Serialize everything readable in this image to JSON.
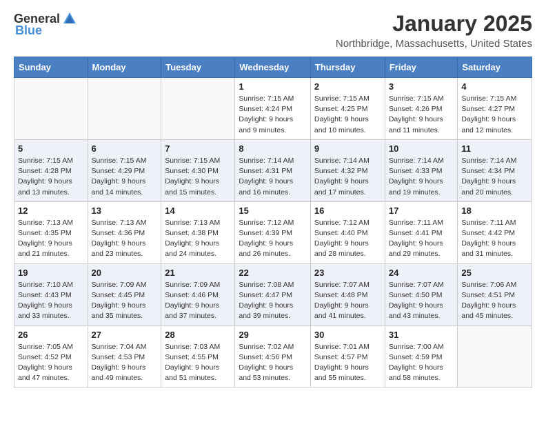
{
  "header": {
    "logo_general": "General",
    "logo_blue": "Blue",
    "month_title": "January 2025",
    "location": "Northbridge, Massachusetts, United States"
  },
  "days_of_week": [
    "Sunday",
    "Monday",
    "Tuesday",
    "Wednesday",
    "Thursday",
    "Friday",
    "Saturday"
  ],
  "weeks": [
    [
      {
        "day": "",
        "info": ""
      },
      {
        "day": "",
        "info": ""
      },
      {
        "day": "",
        "info": ""
      },
      {
        "day": "1",
        "info": "Sunrise: 7:15 AM\nSunset: 4:24 PM\nDaylight: 9 hours\nand 9 minutes."
      },
      {
        "day": "2",
        "info": "Sunrise: 7:15 AM\nSunset: 4:25 PM\nDaylight: 9 hours\nand 10 minutes."
      },
      {
        "day": "3",
        "info": "Sunrise: 7:15 AM\nSunset: 4:26 PM\nDaylight: 9 hours\nand 11 minutes."
      },
      {
        "day": "4",
        "info": "Sunrise: 7:15 AM\nSunset: 4:27 PM\nDaylight: 9 hours\nand 12 minutes."
      }
    ],
    [
      {
        "day": "5",
        "info": "Sunrise: 7:15 AM\nSunset: 4:28 PM\nDaylight: 9 hours\nand 13 minutes."
      },
      {
        "day": "6",
        "info": "Sunrise: 7:15 AM\nSunset: 4:29 PM\nDaylight: 9 hours\nand 14 minutes."
      },
      {
        "day": "7",
        "info": "Sunrise: 7:15 AM\nSunset: 4:30 PM\nDaylight: 9 hours\nand 15 minutes."
      },
      {
        "day": "8",
        "info": "Sunrise: 7:14 AM\nSunset: 4:31 PM\nDaylight: 9 hours\nand 16 minutes."
      },
      {
        "day": "9",
        "info": "Sunrise: 7:14 AM\nSunset: 4:32 PM\nDaylight: 9 hours\nand 17 minutes."
      },
      {
        "day": "10",
        "info": "Sunrise: 7:14 AM\nSunset: 4:33 PM\nDaylight: 9 hours\nand 19 minutes."
      },
      {
        "day": "11",
        "info": "Sunrise: 7:14 AM\nSunset: 4:34 PM\nDaylight: 9 hours\nand 20 minutes."
      }
    ],
    [
      {
        "day": "12",
        "info": "Sunrise: 7:13 AM\nSunset: 4:35 PM\nDaylight: 9 hours\nand 21 minutes."
      },
      {
        "day": "13",
        "info": "Sunrise: 7:13 AM\nSunset: 4:36 PM\nDaylight: 9 hours\nand 23 minutes."
      },
      {
        "day": "14",
        "info": "Sunrise: 7:13 AM\nSunset: 4:38 PM\nDaylight: 9 hours\nand 24 minutes."
      },
      {
        "day": "15",
        "info": "Sunrise: 7:12 AM\nSunset: 4:39 PM\nDaylight: 9 hours\nand 26 minutes."
      },
      {
        "day": "16",
        "info": "Sunrise: 7:12 AM\nSunset: 4:40 PM\nDaylight: 9 hours\nand 28 minutes."
      },
      {
        "day": "17",
        "info": "Sunrise: 7:11 AM\nSunset: 4:41 PM\nDaylight: 9 hours\nand 29 minutes."
      },
      {
        "day": "18",
        "info": "Sunrise: 7:11 AM\nSunset: 4:42 PM\nDaylight: 9 hours\nand 31 minutes."
      }
    ],
    [
      {
        "day": "19",
        "info": "Sunrise: 7:10 AM\nSunset: 4:43 PM\nDaylight: 9 hours\nand 33 minutes."
      },
      {
        "day": "20",
        "info": "Sunrise: 7:09 AM\nSunset: 4:45 PM\nDaylight: 9 hours\nand 35 minutes."
      },
      {
        "day": "21",
        "info": "Sunrise: 7:09 AM\nSunset: 4:46 PM\nDaylight: 9 hours\nand 37 minutes."
      },
      {
        "day": "22",
        "info": "Sunrise: 7:08 AM\nSunset: 4:47 PM\nDaylight: 9 hours\nand 39 minutes."
      },
      {
        "day": "23",
        "info": "Sunrise: 7:07 AM\nSunset: 4:48 PM\nDaylight: 9 hours\nand 41 minutes."
      },
      {
        "day": "24",
        "info": "Sunrise: 7:07 AM\nSunset: 4:50 PM\nDaylight: 9 hours\nand 43 minutes."
      },
      {
        "day": "25",
        "info": "Sunrise: 7:06 AM\nSunset: 4:51 PM\nDaylight: 9 hours\nand 45 minutes."
      }
    ],
    [
      {
        "day": "26",
        "info": "Sunrise: 7:05 AM\nSunset: 4:52 PM\nDaylight: 9 hours\nand 47 minutes."
      },
      {
        "day": "27",
        "info": "Sunrise: 7:04 AM\nSunset: 4:53 PM\nDaylight: 9 hours\nand 49 minutes."
      },
      {
        "day": "28",
        "info": "Sunrise: 7:03 AM\nSunset: 4:55 PM\nDaylight: 9 hours\nand 51 minutes."
      },
      {
        "day": "29",
        "info": "Sunrise: 7:02 AM\nSunset: 4:56 PM\nDaylight: 9 hours\nand 53 minutes."
      },
      {
        "day": "30",
        "info": "Sunrise: 7:01 AM\nSunset: 4:57 PM\nDaylight: 9 hours\nand 55 minutes."
      },
      {
        "day": "31",
        "info": "Sunrise: 7:00 AM\nSunset: 4:59 PM\nDaylight: 9 hours\nand 58 minutes."
      },
      {
        "day": "",
        "info": ""
      }
    ]
  ]
}
